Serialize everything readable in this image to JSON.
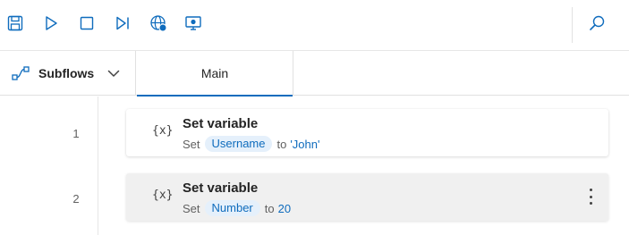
{
  "toolbar": {
    "buttons": [
      {
        "name": "save-icon"
      },
      {
        "name": "run-icon"
      },
      {
        "name": "stop-icon"
      },
      {
        "name": "run-next-action-icon"
      },
      {
        "name": "web-recorder-icon"
      },
      {
        "name": "desktop-recorder-icon"
      }
    ],
    "search_icon": "search-icon",
    "accent_color": "#0f6cbd"
  },
  "tabs": {
    "subflows_label": "Subflows",
    "main_label": "Main"
  },
  "actions": [
    {
      "line": "1",
      "icon_text": "{x}",
      "title": "Set variable",
      "set_word": "Set",
      "variable": "Username",
      "to_word": "to",
      "value": "'John'"
    },
    {
      "line": "2",
      "icon_text": "{x}",
      "title": "Set variable",
      "set_word": "Set",
      "variable": "Number",
      "to_word": "to",
      "value": "20"
    }
  ]
}
